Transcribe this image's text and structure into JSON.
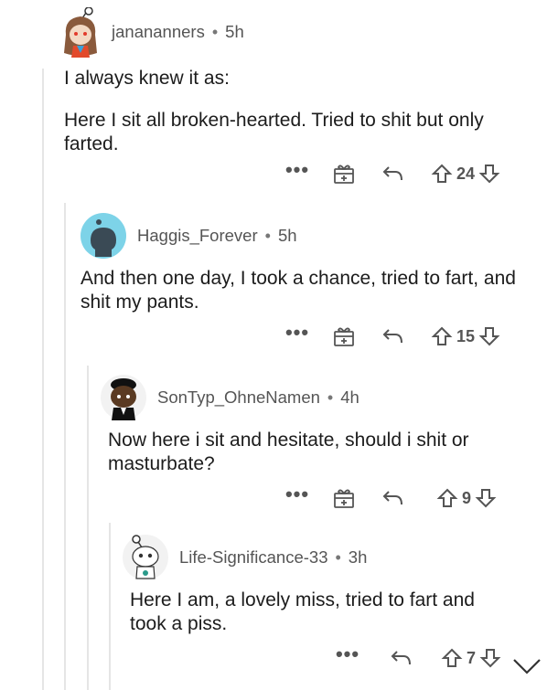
{
  "comments": [
    {
      "username": "janananners",
      "time": "5h",
      "paragraphs": [
        "I always knew it as:",
        "Here I sit all broken-hearted. Tried to shit but only farted."
      ],
      "votes": "24"
    },
    {
      "username": "Haggis_Forever",
      "time": "5h",
      "paragraphs": [
        "And then one day, I took a chance, tried to fart, and shit my pants."
      ],
      "votes": "15"
    },
    {
      "username": "SonTyp_OhneNamen",
      "time": "4h",
      "paragraphs": [
        "Now here i sit and hesitate, should i shit or masturbate?"
      ],
      "votes": "9"
    },
    {
      "username": "Life-Significance-33",
      "time": "3h",
      "paragraphs": [
        "Here I am, a lovely miss, tried to fart and took a piss."
      ],
      "votes": "7"
    }
  ],
  "separator": "•",
  "more_label": "•••",
  "icons": {
    "more": "more-options-icon",
    "award": "award-gift-icon",
    "reply": "reply-arrow-icon",
    "upvote": "upvote-arrow-icon",
    "downvote": "downvote-arrow-icon",
    "collapse": "chevron-down-icon"
  },
  "colors": {
    "text": "#1c1c1c",
    "meta": "#555555",
    "thread_line": "#e5e5e5",
    "avatar_blue": "#7dd3e8"
  }
}
